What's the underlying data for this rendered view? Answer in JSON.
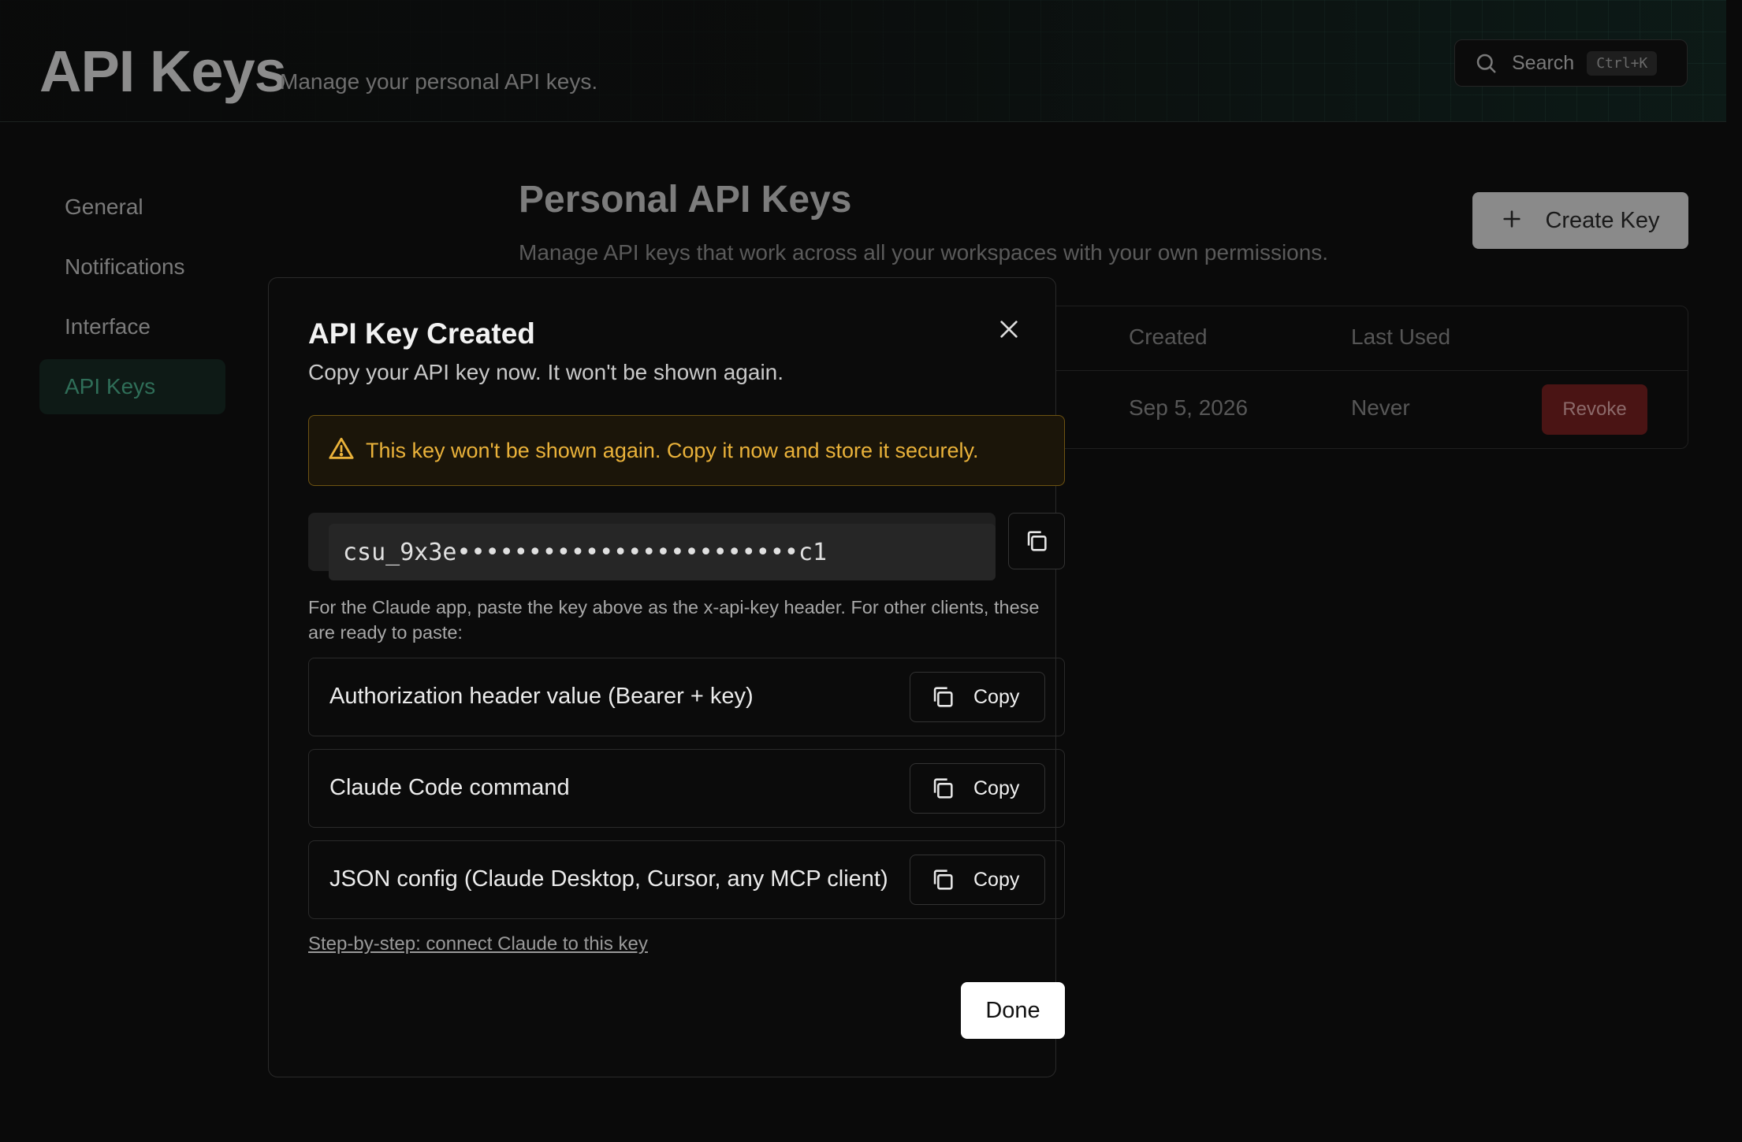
{
  "header": {
    "title": "API Keys",
    "subtitle": "Manage your personal API keys.",
    "search": {
      "label": "Search",
      "shortcut": "Ctrl+K"
    }
  },
  "sidebar": {
    "items": [
      {
        "label": "General",
        "active": false
      },
      {
        "label": "Notifications",
        "active": false
      },
      {
        "label": "Interface",
        "active": false
      },
      {
        "label": "API Keys",
        "active": true
      }
    ]
  },
  "main": {
    "title": "Personal API Keys",
    "description": "Manage API keys that work across all your workspaces with your own permissions.",
    "create_button": "Create Key",
    "table": {
      "headers": {
        "created": "Created",
        "last_used": "Last Used"
      },
      "rows": [
        {
          "created": "Sep 5, 2026",
          "last_used": "Never",
          "action": "Revoke"
        }
      ]
    }
  },
  "modal": {
    "title": "API Key Created",
    "subtitle": "Copy your API key now. It won't be shown again.",
    "warning": "This key won't be shown again. Copy it now and store it securely.",
    "key_value": "csu_9x3e••••••••••••••••••••••••c1",
    "hint": "For the Claude app, paste the key above as the x-api-key header. For other clients, these are ready to paste:",
    "snippets": [
      {
        "label": "Authorization header value (Bearer + key)",
        "button": "Copy"
      },
      {
        "label": "Claude Code command",
        "button": "Copy"
      },
      {
        "label": "JSON config (Claude Desktop, Cursor, any MCP client)",
        "button": "Copy"
      }
    ],
    "guide_link": "Step-by-step: connect Claude to this key",
    "done_button": "Done"
  },
  "colors": {
    "background": "#0a0a0a",
    "accent_active": "#2f6e58",
    "warning_text": "#eab23a",
    "warning_border": "#6e5312",
    "revoke": "#4a1414"
  },
  "icons": [
    "search-icon",
    "plus-icon",
    "close-icon",
    "warning-icon",
    "copy-icon"
  ]
}
